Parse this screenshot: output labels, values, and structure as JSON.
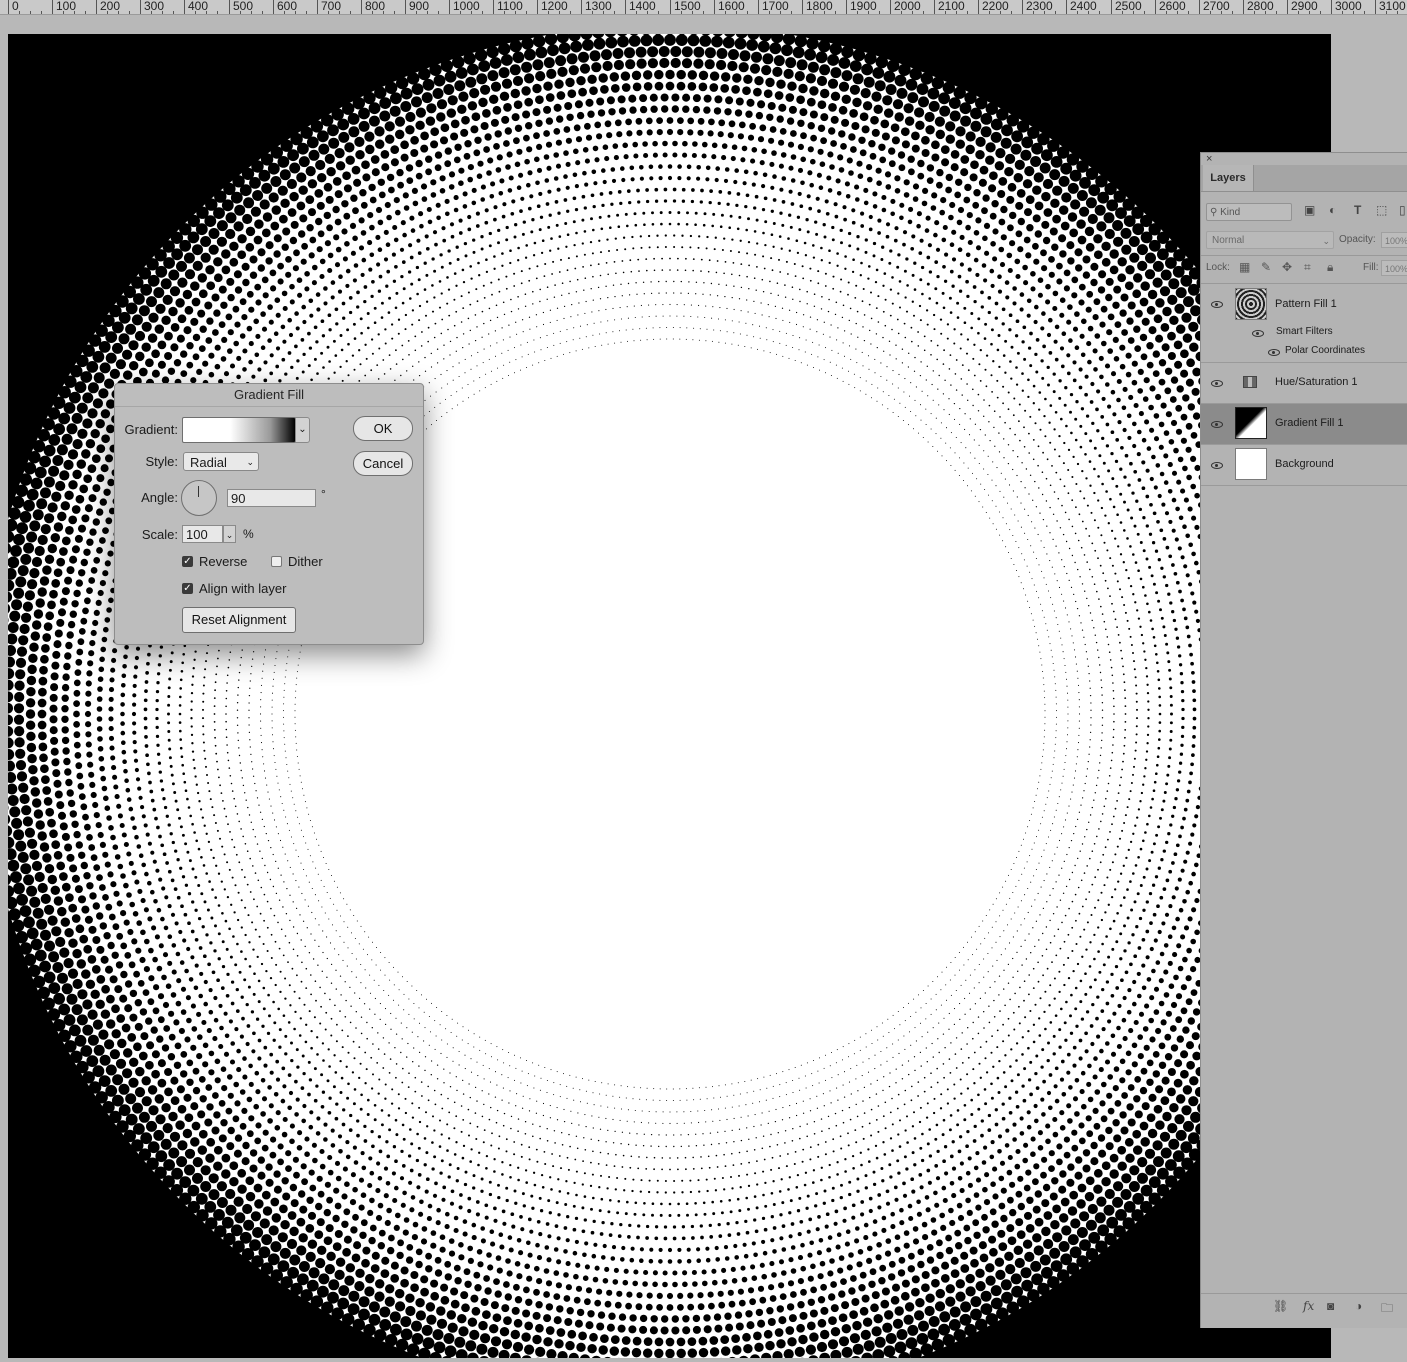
{
  "ruler": {
    "labels": [
      "0",
      "100",
      "200",
      "300",
      "400",
      "500",
      "600",
      "700",
      "800",
      "900",
      "1000",
      "1100",
      "1200",
      "1300",
      "1400",
      "1500",
      "1600",
      "1700",
      "1800",
      "1900",
      "2000",
      "2100",
      "2200",
      "2300",
      "2400",
      "2500",
      "2600",
      "2700",
      "2800",
      "2900",
      "3000",
      "3100"
    ]
  },
  "dialog": {
    "title": "Gradient Fill",
    "gradient_label": "Gradient:",
    "style_label": "Style:",
    "style_value": "Radial",
    "angle_label": "Angle:",
    "angle_value": "90",
    "degree_symbol": "°",
    "scale_label": "Scale:",
    "scale_value": "100",
    "percent_symbol": "%",
    "reverse_label": "Reverse",
    "reverse_checked": true,
    "dither_label": "Dither",
    "dither_checked": false,
    "align_label": "Align with layer",
    "align_checked": true,
    "reset_label": "Reset Alignment",
    "ok_label": "OK",
    "cancel_label": "Cancel"
  },
  "layers_panel": {
    "close_glyph": "×",
    "tab_label": "Layers",
    "kind_placeholder": "Kind",
    "blend_mode": "Normal",
    "opacity_label": "Opacity:",
    "opacity_value": "100%",
    "lock_label": "Lock:",
    "fill_label": "Fill:",
    "fill_value": "100%",
    "layers": [
      {
        "name": "Pattern Fill 1",
        "visible": true,
        "selected": false
      },
      {
        "name": "Smart Filters",
        "visible": true,
        "sub": true
      },
      {
        "name": "Polar Coordinates",
        "visible": true,
        "sub": true
      },
      {
        "name": "Hue/Saturation 1",
        "visible": true,
        "selected": false
      },
      {
        "name": "Gradient Fill 1",
        "visible": true,
        "selected": true
      },
      {
        "name": "Background",
        "visible": true,
        "selected": false
      }
    ]
  },
  "colors": {
    "canvas": "#000000",
    "dots": "#ffffff",
    "selected_row": "#8b8b8b"
  }
}
